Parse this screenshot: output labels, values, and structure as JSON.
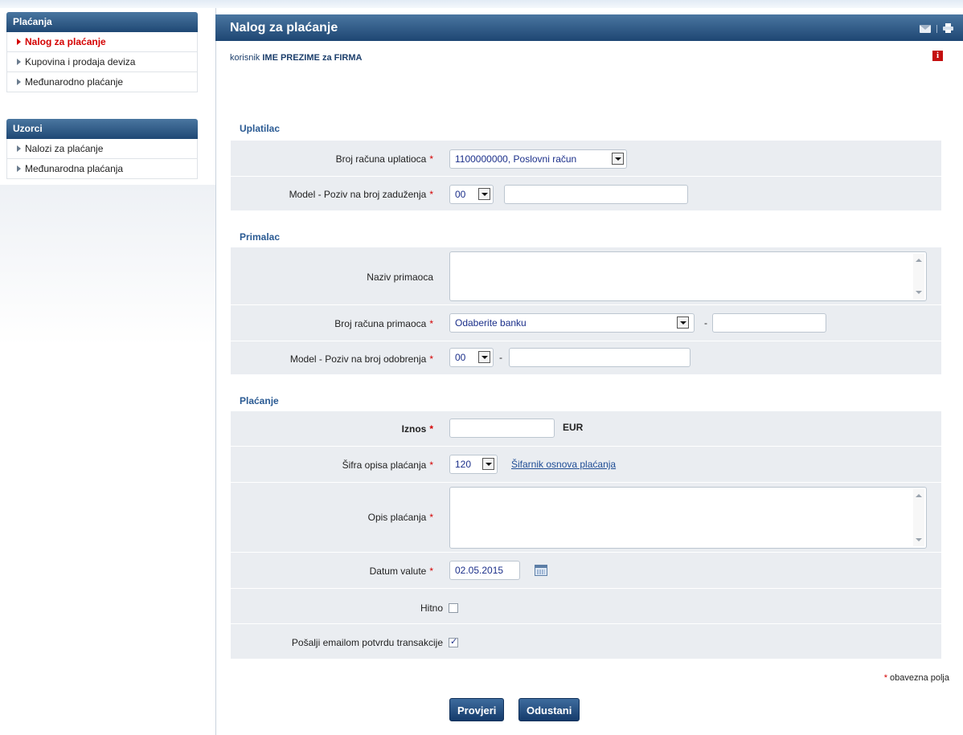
{
  "sidebar": {
    "sections": [
      {
        "title": "Plaćanja",
        "items": [
          "Nalog za plaćanje",
          "Kupovina i prodaja deviza",
          "Međunarodno plaćanje"
        ]
      },
      {
        "title": "Uzorci",
        "items": [
          "Nalozi za plaćanje",
          "Međunarodna plaćanja"
        ]
      }
    ],
    "active_item": "Nalog za plaćanje"
  },
  "header": {
    "title": "Nalog za plaćanje",
    "icons": [
      "mail-icon",
      "print-icon"
    ]
  },
  "user": {
    "prefix": "korisnik",
    "name": "IME PREZIME",
    "middle": "za",
    "company": "FIRMA"
  },
  "form": {
    "sections": {
      "payer": "Uplatilac",
      "recipient": "Primalac",
      "payment": "Plaćanje"
    },
    "payer_account": {
      "label": "Broj računa uplatioca",
      "value": "1100000000, Poslovni račun"
    },
    "debit_model": {
      "label": "Model - Poziv na broj zaduženja",
      "model": "00",
      "reference": ""
    },
    "recipient_name": {
      "label": "Naziv primaoca",
      "value": ""
    },
    "recipient_account": {
      "label": "Broj računa primaoca",
      "bank": "Odaberite banku",
      "dash": "-",
      "number": ""
    },
    "credit_model": {
      "label": "Model - Poziv na broj odobrenja",
      "model": "00",
      "dash": "-",
      "reference": ""
    },
    "amount": {
      "label": "Iznos",
      "value": "",
      "currency": "EUR"
    },
    "payment_code": {
      "label": "Šifra opisa plaćanja",
      "value": "120",
      "link": "Šifarnik osnova plaćanja"
    },
    "description": {
      "label": "Opis plaćanja",
      "value": ""
    },
    "value_date": {
      "label": "Datum valute",
      "value": "02.05.2015"
    },
    "urgent": {
      "label": "Hitno",
      "checked": false
    },
    "email_confirm": {
      "label": "Pošalji emailom potvrdu transakcije",
      "checked": true
    },
    "required_marker": "*",
    "required_note": "obavezna polja"
  },
  "buttons": {
    "check": "Provjeri",
    "cancel": "Odustani"
  },
  "colors": {
    "header": "#1e4673",
    "required": "#d40000",
    "section_title": "#2a5a93",
    "row_bg": "#eaedf1"
  }
}
